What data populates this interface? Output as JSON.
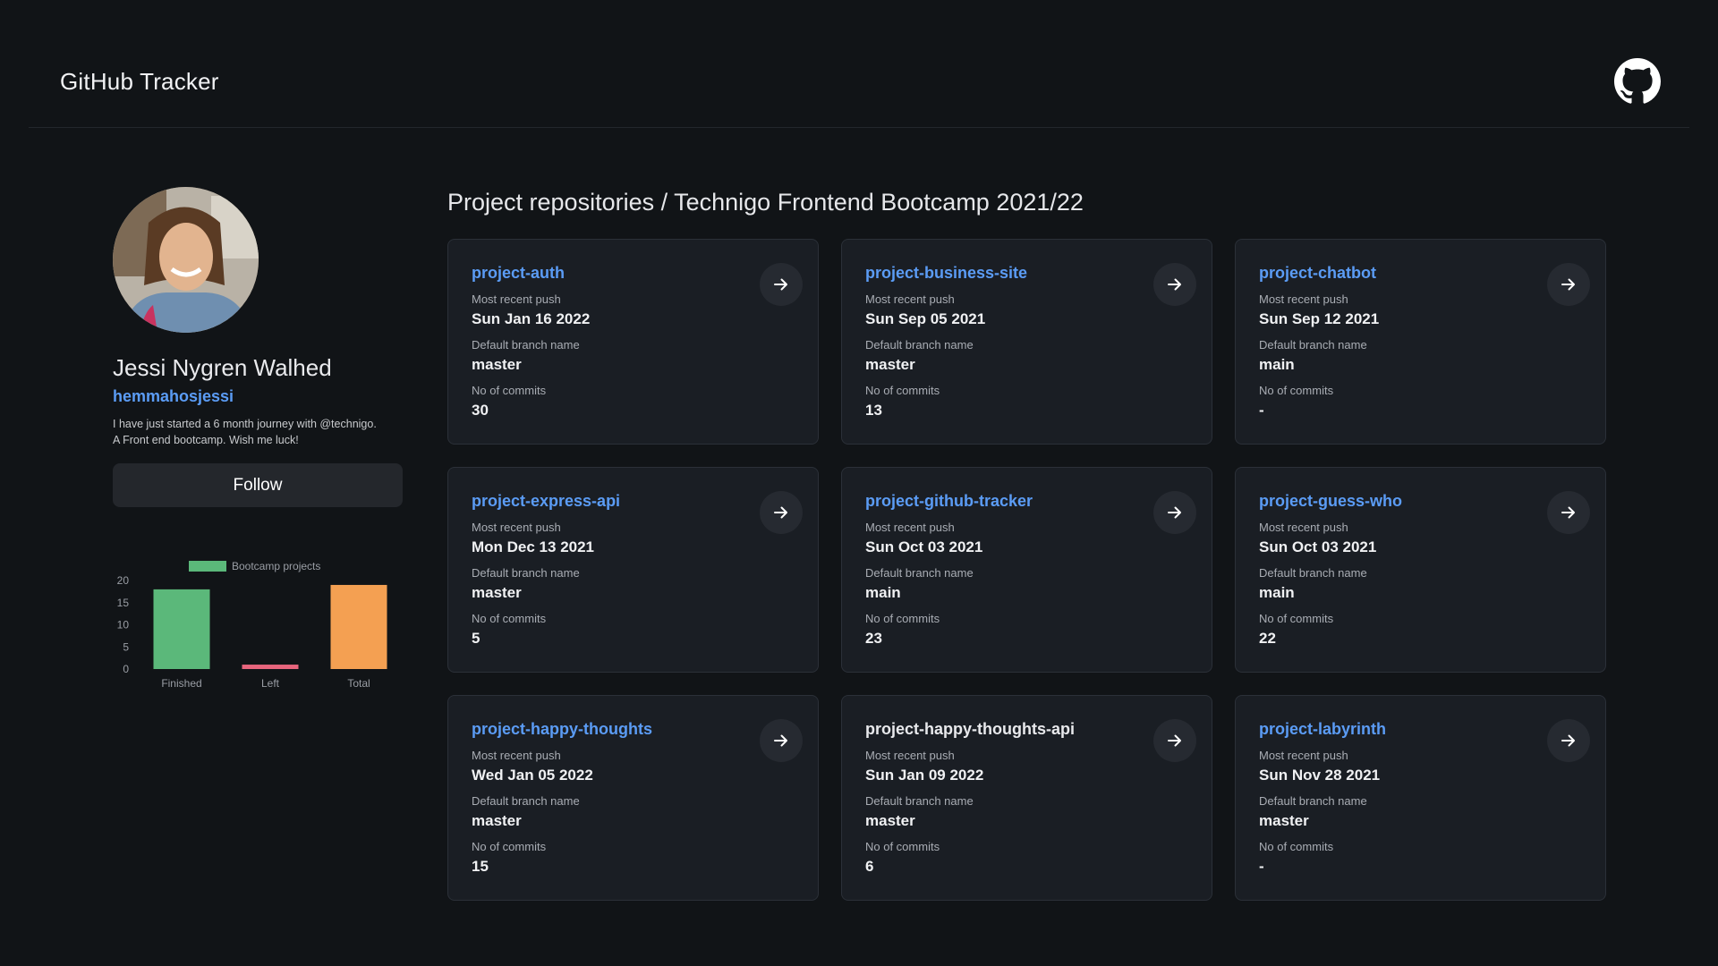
{
  "header": {
    "title": "GitHub Tracker",
    "logo_icon": "github-icon"
  },
  "profile": {
    "name": "Jessi Nygren Walhed",
    "username": "hemmahosjessi",
    "bio_line1": "I have just started a 6 month journey with @technigo.",
    "bio_line2": "A Front end bootcamp. Wish me luck!",
    "follow_label": "Follow"
  },
  "chart_data": {
    "type": "bar",
    "categories": [
      "Finished",
      "Left",
      "Total"
    ],
    "values": [
      18,
      1,
      19
    ],
    "series_name": "Bootcamp projects",
    "colors": [
      "#5bb87a",
      "#e8657d",
      "#f4a052"
    ],
    "legend_color": "#5bb87a",
    "yticks": [
      0,
      5,
      10,
      15,
      20
    ],
    "ylim": [
      0,
      20
    ],
    "legend_position": "top"
  },
  "repos": {
    "title": "Project repositories / Technigo Frontend Bootcamp 2021/22",
    "push_label": "Most recent push",
    "branch_label": "Default branch name",
    "commits_label": "No of commits",
    "items": [
      {
        "name": "project-auth",
        "push": "Sun Jan 16 2022",
        "branch": "master",
        "commits": "30",
        "linked": true
      },
      {
        "name": "project-business-site",
        "push": "Sun Sep 05 2021",
        "branch": "master",
        "commits": "13",
        "linked": true
      },
      {
        "name": "project-chatbot",
        "push": "Sun Sep 12 2021",
        "branch": "main",
        "commits": "-",
        "linked": true
      },
      {
        "name": "project-express-api",
        "push": "Mon Dec 13 2021",
        "branch": "master",
        "commits": "5",
        "linked": true
      },
      {
        "name": "project-github-tracker",
        "push": "Sun Oct 03 2021",
        "branch": "main",
        "commits": "23",
        "linked": true
      },
      {
        "name": "project-guess-who",
        "push": "Sun Oct 03 2021",
        "branch": "main",
        "commits": "22",
        "linked": true
      },
      {
        "name": "project-happy-thoughts",
        "push": "Wed Jan 05 2022",
        "branch": "master",
        "commits": "15",
        "linked": true
      },
      {
        "name": "project-happy-thoughts-api",
        "push": "Sun Jan 09 2022",
        "branch": "master",
        "commits": "6",
        "linked": false
      },
      {
        "name": "project-labyrinth",
        "push": "Sun Nov 28 2021",
        "branch": "master",
        "commits": "-",
        "linked": true
      }
    ]
  },
  "colors": {
    "background": "#111417",
    "card": "#1a1e24",
    "accent": "#5b9cf5"
  }
}
